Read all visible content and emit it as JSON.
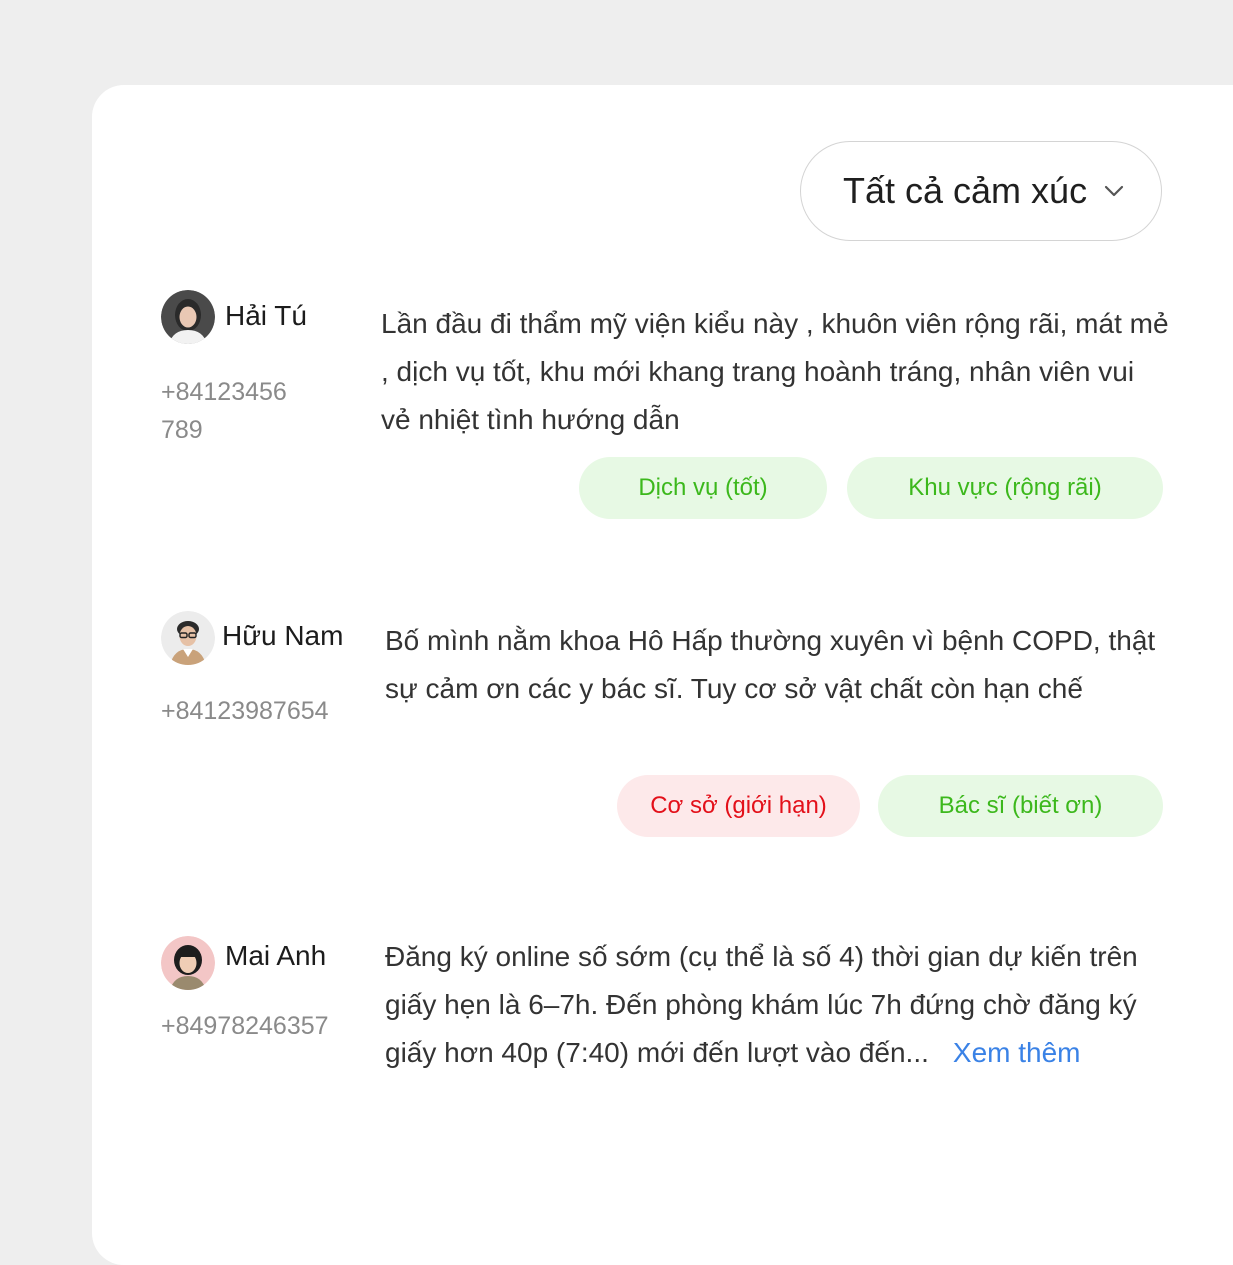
{
  "filter": {
    "label": "Tất cả cảm xúc"
  },
  "reviews": [
    {
      "name": "Hải Tú",
      "phone_line1": "+84123456",
      "phone_line2": "789",
      "text": "Lần đầu đi thẩm mỹ viện kiểu này , khuôn viên rộng rãi, mát mẻ , dịch vụ tốt, khu mới khang trang hoành tráng, nhân viên vui vẻ nhiệt tình hướng dẫn",
      "tags": [
        {
          "label": "Dịch vụ (tốt)",
          "sentiment": "positive"
        },
        {
          "label": "Khu vực (rộng rãi)",
          "sentiment": "positive"
        }
      ]
    },
    {
      "name": "Hữu Nam",
      "phone": "+84123987654",
      "text": "Bố mình nằm khoa Hô Hấp thường xuyên vì bệnh COPD, thật sự cảm ơn các y bác sĩ. Tuy cơ sở vật chất còn hạn chế",
      "tags": [
        {
          "label": "Cơ sở (giới hạn)",
          "sentiment": "negative"
        },
        {
          "label": "Bác sĩ (biết ơn)",
          "sentiment": "positive"
        }
      ]
    },
    {
      "name": "Mai Anh",
      "phone": "+84978246357",
      "text": "Đăng ký online số sớm (cụ thể là số 4) thời gian dự kiến trên giấy hẹn là 6–7h. Đến phòng khám lúc 7h đứng chờ đăng ký giấy hơn 40p (7:40) mới đến lượt vào đến...",
      "more_label": "Xem thêm"
    }
  ],
  "colors": {
    "positive_bg": "#e7f9e4",
    "positive_text": "#3cb81c",
    "negative_bg": "#fde9ea",
    "negative_text": "#e3101a",
    "link": "#3a82e6"
  }
}
